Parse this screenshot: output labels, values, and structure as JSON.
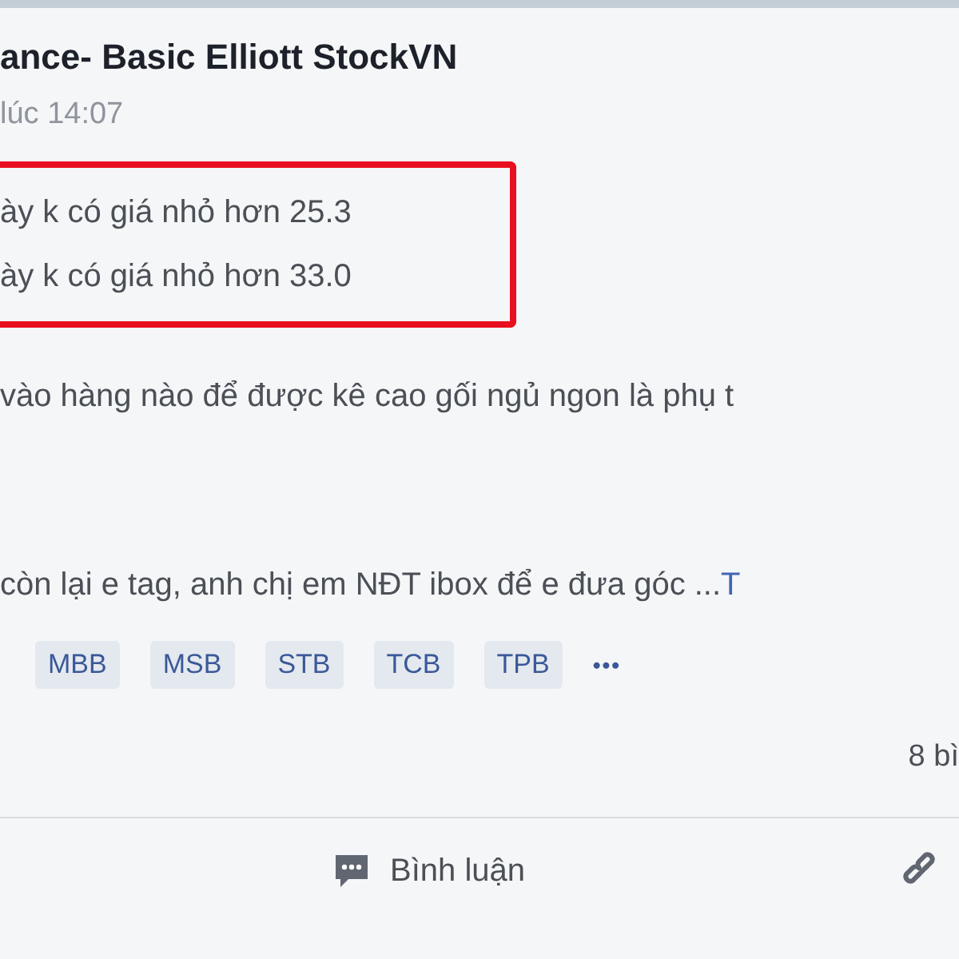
{
  "post": {
    "author": "ance- Basic Elliott StockVN",
    "time": "lúc 14:07",
    "highlight_lines": [
      "ày k có giá nhỏ hơn 25.3",
      "ày k có giá nhỏ hơn 33.0"
    ],
    "body_lines": [
      "vào hàng nào để được kê cao gối ngủ ngon là phụ t",
      "còn lại e tag, anh chị em NĐT ibox để e đưa góc ..."
    ],
    "more_link": "T",
    "tags": [
      "MBB",
      "MSB",
      "STB",
      "TCB",
      "TPB"
    ],
    "tags_more": "•••",
    "comment_count": "8 bì",
    "actions": [
      {
        "kind": "comment",
        "label": "Bình luận"
      },
      {
        "kind": "link"
      }
    ]
  }
}
